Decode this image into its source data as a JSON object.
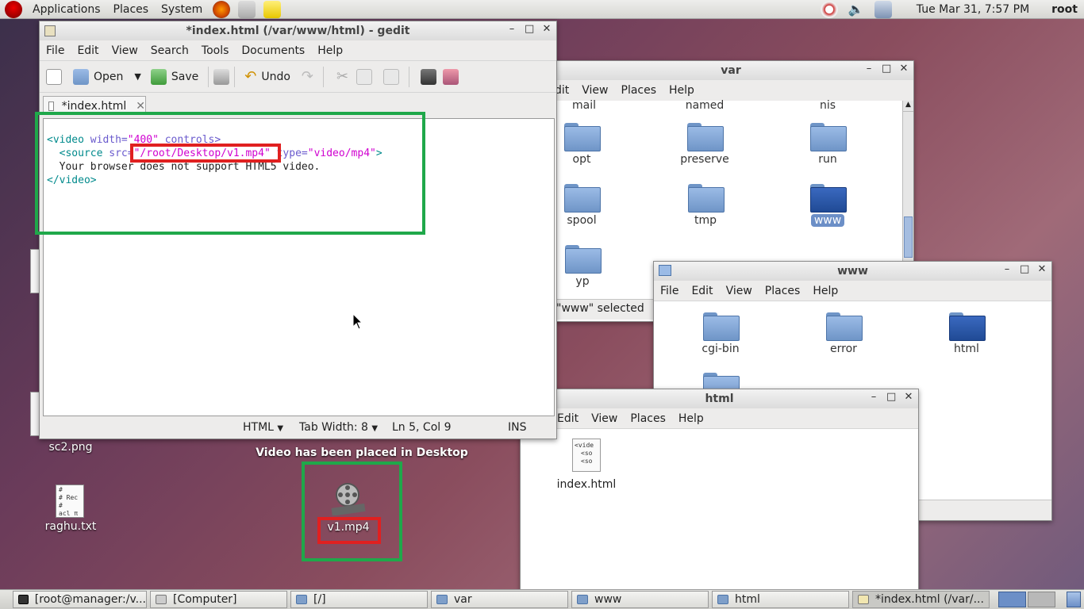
{
  "topbar": {
    "menus": [
      "Applications",
      "Places",
      "System"
    ],
    "clock": "Tue Mar 31,  7:57 PM",
    "user": "root"
  },
  "gedit": {
    "title": "*index.html (/var/www/html) - gedit",
    "menus": [
      "File",
      "Edit",
      "View",
      "Search",
      "Tools",
      "Documents",
      "Help"
    ],
    "toolbar": {
      "open": "Open",
      "save": "Save",
      "undo": "Undo"
    },
    "tab": "*index.html",
    "code": {
      "l1_a": "<video ",
      "l1_attr": "width=",
      "l1_val": "\"400\"",
      "l1_b": " controls>",
      "l2_a": "  <source ",
      "l2_attr": "src=",
      "l2_val": "\"/root/Desktop/v1.mp4\"",
      "l2_attr2": " type=",
      "l2_val2": "\"video/mp4\"",
      "l2_b": ">",
      "l3": "  Your browser does not support HTML5 video.",
      "l4": "</video>"
    },
    "status": {
      "lang": "HTML",
      "tab": "Tab Width:  8",
      "pos": "Ln 5, Col 9",
      "mode": "INS"
    }
  },
  "var": {
    "title": "var",
    "menus": [
      "dit",
      "View",
      "Places",
      "Help"
    ],
    "partial": [
      "mail",
      "named",
      "nis"
    ],
    "folders": [
      "opt",
      "preserve",
      "run",
      "spool",
      "tmp",
      "www",
      "yp"
    ],
    "status": "\"www\" selected"
  },
  "www": {
    "title": "www",
    "menus": [
      "File",
      "Edit",
      "View",
      "Places",
      "Help"
    ],
    "folders": [
      "cgi-bin",
      "error",
      "html"
    ]
  },
  "html": {
    "title": "html",
    "menus": [
      "Edit",
      "View",
      "Places",
      "Help"
    ],
    "file": "index.html",
    "thumb": [
      "<vide",
      "<so",
      "<so"
    ]
  },
  "desktop": {
    "sc2": "sc2.png",
    "raghu": "raghu.txt",
    "raghu_thumb": [
      "#",
      "# Rec",
      "#",
      "acl π"
    ],
    "video": "v1.mp4",
    "note": "Video has been placed in Desktop"
  },
  "taskbar": [
    "[root@manager:/v...",
    "[Computer]",
    "[/]",
    "var",
    "www",
    "html",
    "*index.html (/var/..."
  ]
}
